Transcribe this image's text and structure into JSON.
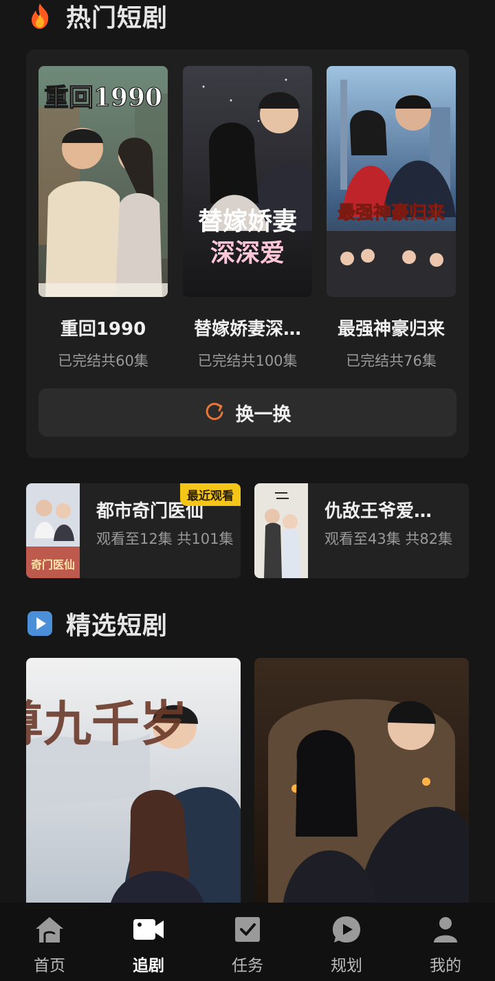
{
  "sections": {
    "hot_title": "热门短剧",
    "featured_title": "精选短剧"
  },
  "hot_dramas": [
    {
      "name": "重回1990",
      "meta": "已完结共60集",
      "poster_text": "重回1990"
    },
    {
      "name": "替嫁娇妻深…",
      "meta": "已完结共100集",
      "poster_text_1": "替嫁娇妻",
      "poster_text_2": "深深爱"
    },
    {
      "name": "最强神豪归来",
      "meta": "已完结共76集",
      "poster_text": "最强神豪归来"
    }
  ],
  "refresh_label": "换一换",
  "recent": [
    {
      "name": "都市奇门医仙",
      "progress": "观看至12集 共101集",
      "badge": "最近观看",
      "poster_text": "奇门医仙"
    },
    {
      "name": "仇敌王爷爱…",
      "progress": "观看至43集 共82集"
    }
  ],
  "featured": [
    {
      "poster_text": "师尊九千岁"
    },
    {}
  ],
  "tabs": [
    {
      "label": "首页",
      "icon": "home-icon",
      "active": false
    },
    {
      "label": "追剧",
      "icon": "video-camera-icon",
      "active": true
    },
    {
      "label": "任务",
      "icon": "task-check-icon",
      "active": false
    },
    {
      "label": "规划",
      "icon": "play-bubble-icon",
      "active": false
    },
    {
      "label": "我的",
      "icon": "user-icon",
      "active": false
    }
  ],
  "colors": {
    "background": "#161616",
    "panel": "#1f1f1f",
    "badge": "#f5c518",
    "refresh_icon": "#e8763a"
  }
}
